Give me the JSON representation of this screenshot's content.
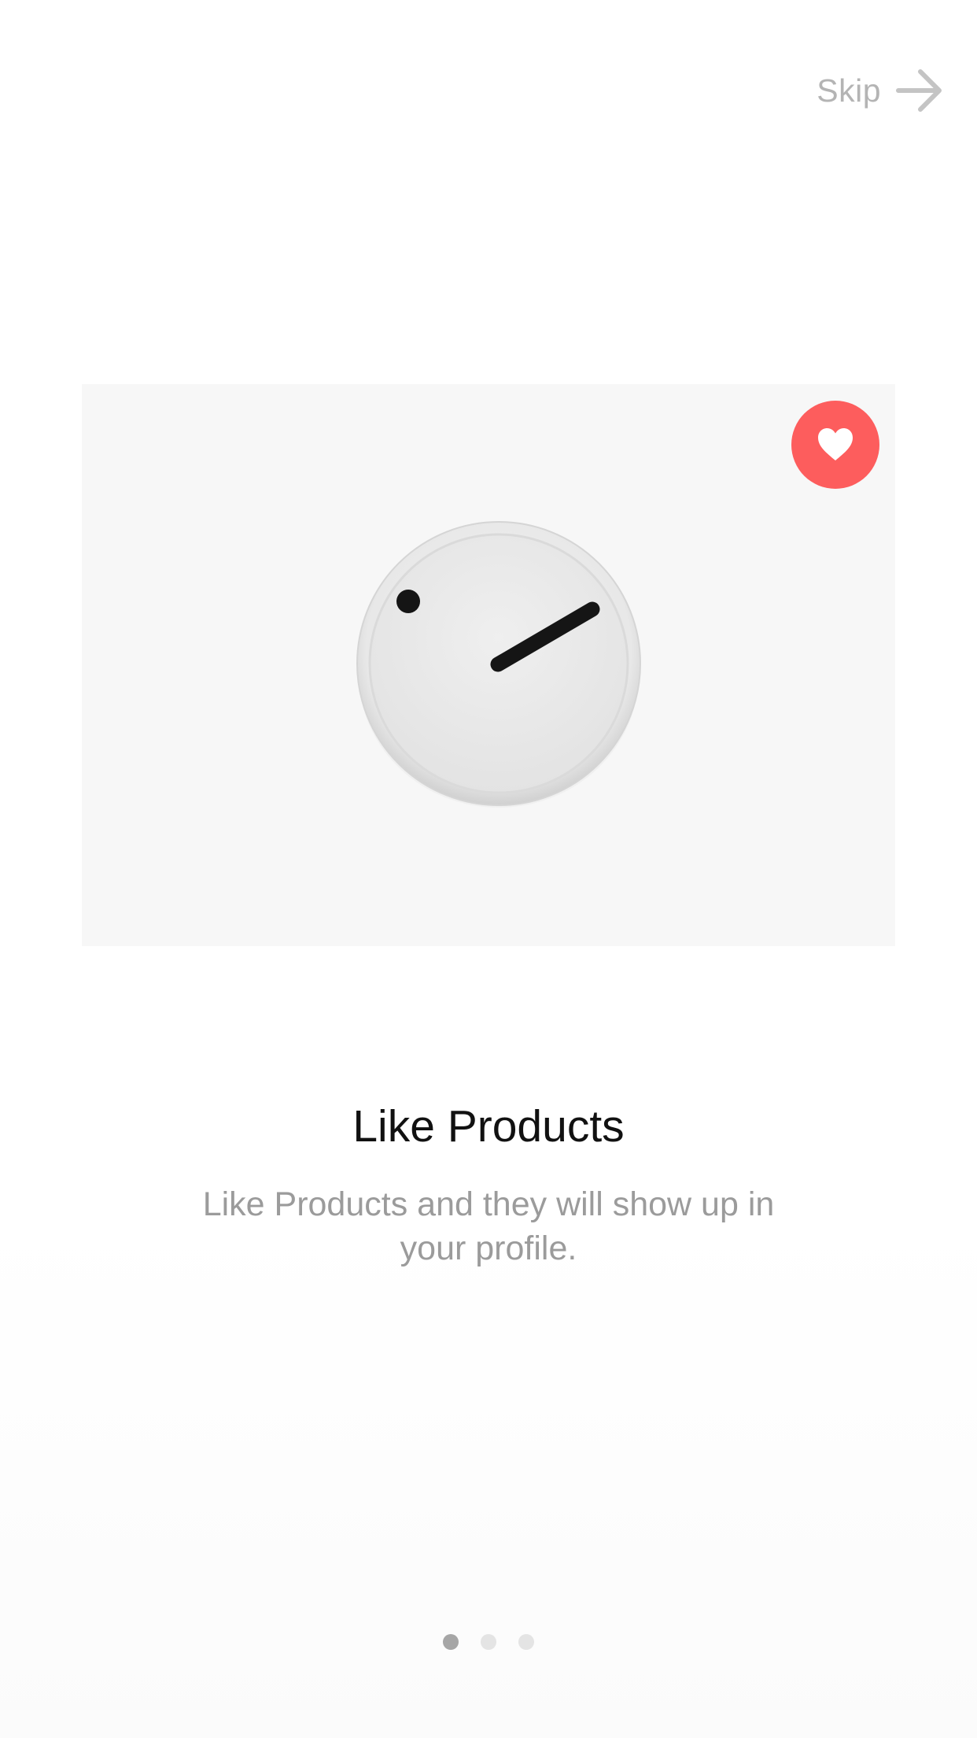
{
  "skip": {
    "label": "Skip",
    "icon": "arrow-right-icon"
  },
  "product": {
    "image": "wall-clock-product-image",
    "like_icon": "heart-icon",
    "liked": true
  },
  "onboarding": {
    "title": "Like Products",
    "description": "Like Products and they will show up in your profile."
  },
  "pagination": {
    "total": 3,
    "current": 1
  },
  "colors": {
    "accent": "#fd5d5d",
    "title": "#111111",
    "muted_text": "#9b9b9b",
    "skip_text": "#b4b4b4",
    "dot_active": "#a6a6a6",
    "dot_inactive": "#e4e4e4",
    "card_background": "#f7f7f7"
  }
}
